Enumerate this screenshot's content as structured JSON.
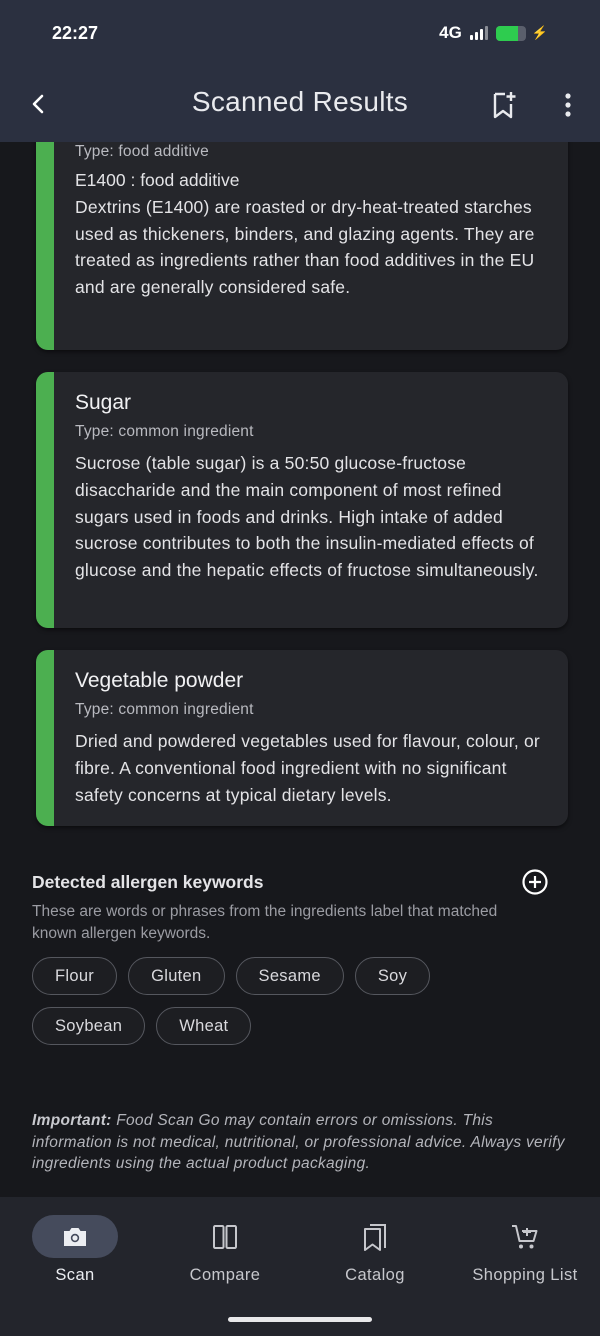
{
  "status": {
    "time": "22:27",
    "network": "4G",
    "battery_level": 0.75,
    "battery_color": "#2ecc4f"
  },
  "header": {
    "title": "Scanned Results",
    "back_icon": "chevron-left-icon",
    "bookmark_icon": "bookmark-add-icon",
    "more_icon": "more-vertical-icon"
  },
  "ingredients": [
    {
      "type": "Type: food additive",
      "code": "E1400 : food additive",
      "description": "Dextrins (E1400) are roasted or dry-heat-treated starches used as thickeners, binders, and glazing agents. They are treated as ingredients rather than food additives in the EU and are generally considered safe."
    },
    {
      "name": "Sugar",
      "type": "Type: common ingredient",
      "description": "Sucrose (table sugar) is a 50:50 glucose-fructose disaccharide and the main component of most refined sugars used in foods and drinks. High intake of added sucrose contributes to both the insulin-mediated effects of glucose and the hepatic effects of fructose simultaneously."
    },
    {
      "name": "Vegetable powder",
      "type": "Type: common ingredient",
      "description": "Dried and powdered vegetables used for flavour, colour, or fibre. A conventional food ingredient with no significant safety concerns at typical dietary levels."
    }
  ],
  "allergens": {
    "title": "Detected allergen keywords",
    "description": "These are words or phrases from the ingredients label that matched known allergen keywords.",
    "keywords": [
      "Flour",
      "Gluten",
      "Sesame",
      "Soy",
      "Soybean",
      "Wheat"
    ]
  },
  "disclaimer": {
    "label": "Important:",
    "text": " Food Scan Go may contain errors or omissions. This information is not medical, nutritional, or professional advice. Always verify ingredients using the actual product packaging."
  },
  "nav": {
    "items": [
      {
        "label": "Scan",
        "icon": "camera-icon",
        "active": true
      },
      {
        "label": "Compare",
        "icon": "compare-icon",
        "active": false
      },
      {
        "label": "Catalog",
        "icon": "catalog-icon",
        "active": false
      },
      {
        "label": "Shopping List",
        "icon": "cart-icon",
        "active": false
      }
    ]
  },
  "colors": {
    "accent_stripe": "#4caf50",
    "app_bar": "#2b3040",
    "background": "#17181c"
  }
}
